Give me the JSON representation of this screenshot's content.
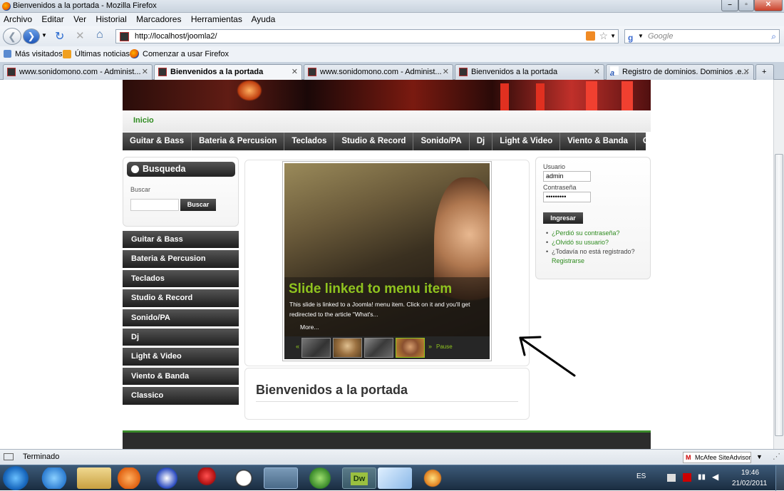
{
  "window": {
    "title": "Bienvenidos a la portada - Mozilla Firefox"
  },
  "menubar": [
    "Archivo",
    "Editar",
    "Ver",
    "Historial",
    "Marcadores",
    "Herramientas",
    "Ayuda"
  ],
  "navbar": {
    "url": "http://localhost/joomla2/",
    "search_placeholder": "Google"
  },
  "bookmarks": [
    "Más visitados",
    "Últimas noticias",
    "Comenzar a usar Firefox"
  ],
  "tabs": [
    {
      "label": "www.sonidomono.com - Administ...",
      "active": false
    },
    {
      "label": "Bienvenidos a la portada",
      "active": true
    },
    {
      "label": "www.sonidomono.com - Administ...",
      "active": false
    },
    {
      "label": "Bienvenidos a la portada",
      "active": false
    },
    {
      "label": "Registro de dominios. Dominios .e...",
      "active": false
    }
  ],
  "page": {
    "home_link": "Inicio",
    "top_nav": [
      "Guitar & Bass",
      "Bateria & Percusion",
      "Teclados",
      "Studio & Record",
      "Sonido/PA",
      "Dj",
      "Light & Video",
      "Viento & Banda",
      "Classico"
    ],
    "search_module": {
      "title": "Busqueda",
      "label": "Buscar",
      "button": "Buscar"
    },
    "left_menu": [
      "Guitar & Bass",
      "Bateria & Percusion",
      "Teclados",
      "Studio & Record",
      "Sonido/PA",
      "Dj",
      "Light & Video",
      "Viento & Banda",
      "Classico"
    ],
    "slide": {
      "title": "Slide linked to menu item",
      "text_line1": "This slide is linked to a Joomla! menu item. Click on it and you'll get",
      "text_line2": "redirected to the article \"What's...",
      "more": "More...",
      "prev": "«",
      "next": "»",
      "pause": "Pause"
    },
    "welcome_title": "Bienvenidos a la portada",
    "login": {
      "user_label": "Usuario",
      "user_value": "admin",
      "pass_label": "Contraseña",
      "pass_value": "•••••••••",
      "button": "Ingresar",
      "links": [
        "¿Perdió su contraseña?",
        "¿Olvidó su usuario?"
      ],
      "register_prompt": "¿Todavía no está registrado?",
      "register_link": "Registrarse"
    }
  },
  "statusbar": {
    "text": "Terminado",
    "addon": "McAfee SiteAdvisor"
  },
  "taskbar": {
    "lang": "ES",
    "time": "19:46",
    "date": "21/02/2011"
  },
  "colors": {
    "accent_green": "#8fc31f",
    "link_green": "#2e8b1f",
    "nav_dark": "#2c2c2c"
  }
}
